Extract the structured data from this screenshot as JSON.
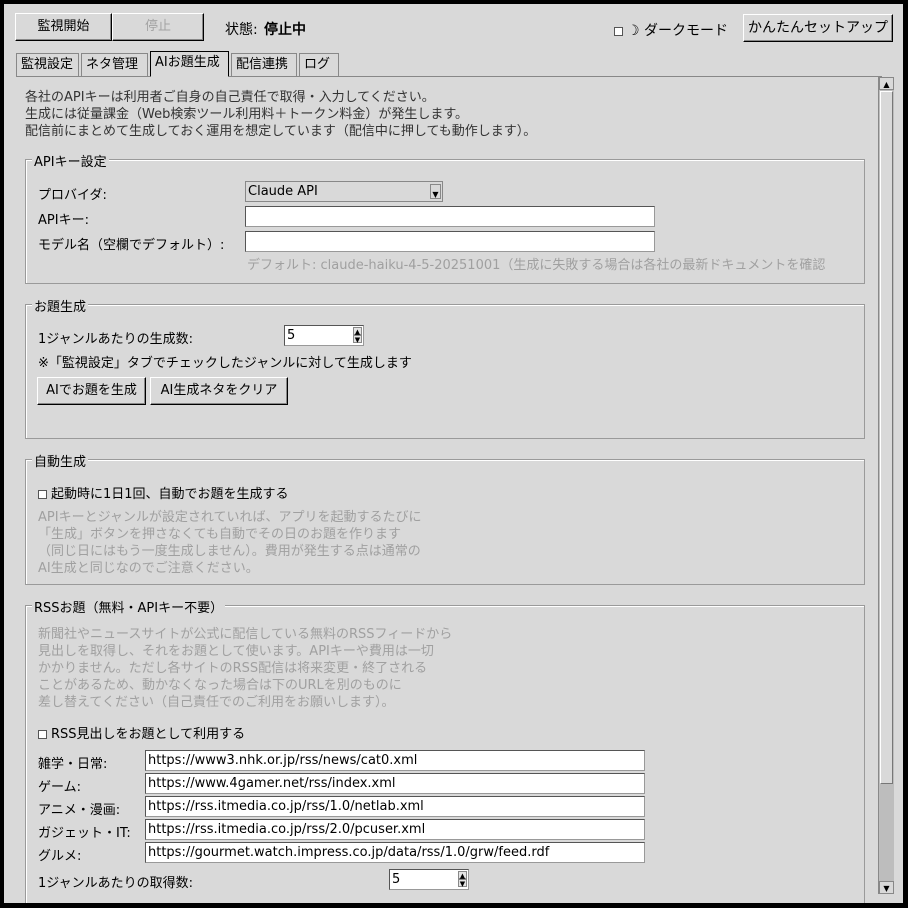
{
  "toolbar": {
    "start_label": "監視開始",
    "stop_label": "停止",
    "status_label": "状態:",
    "status_value": "停止中",
    "dark_mode_label": "ダークモード",
    "dark_mode_icon": "moon-icon",
    "easy_setup_label": "かんたんセットアップ"
  },
  "tabs": [
    {
      "label": "監視設定",
      "active": false
    },
    {
      "label": "ネタ管理",
      "active": false
    },
    {
      "label": "AIお題生成",
      "active": true
    },
    {
      "label": "配信連携",
      "active": false
    },
    {
      "label": "ログ",
      "active": false
    }
  ],
  "notice": [
    "各社のAPIキーは利用者ご自身の自己責任で取得・入力してください。",
    "生成には従量課金（Web検索ツール利用料＋トークン料金）が発生します。",
    "配信前にまとめて生成しておく運用を想定しています（配信中に押しても動作します）。"
  ],
  "api_settings": {
    "title": "APIキー設定",
    "provider_label": "プロバイダ:",
    "provider_value": "Claude API",
    "api_key_label": "APIキー:",
    "api_key_value": "",
    "model_label": "モデル名（空欄でデフォルト）:",
    "model_value": "",
    "default_hint": "デフォルト: claude-haiku-4-5-20251001（生成に失敗する場合は各社の最新ドキュメントを確認"
  },
  "generation": {
    "title": "お題生成",
    "count_label": "1ジャンルあたりの生成数:",
    "count_value": "5",
    "note": "※「監視設定」タブでチェックしたジャンルに対して生成します",
    "generate_label": "AIでお題を生成",
    "clear_label": "AI生成ネタをクリア"
  },
  "auto": {
    "title": "自動生成",
    "checkbox_label": "起動時に1日1回、自動でお題を生成する",
    "checked": false,
    "hint": "APIキーとジャンルが設定されていれば、アプリを起動するたびに\n「生成」ボタンを押さなくても自動でその日のお題を作ります\n（同じ日にはもう一度生成しません）。費用が発生する点は通常の\nAI生成と同じなのでご注意ください。"
  },
  "rss": {
    "title": "RSSお題（無料・APIキー不要）",
    "hint": "新聞社やニュースサイトが公式に配信している無料のRSSフィードから\n見出しを取得し、それをお題として使います。APIキーや費用は一切\nかかりません。ただし各サイトのRSS配信は将来変更・終了される\nことがあるため、動かなくなった場合は下のURLを別のものに\n差し替えてください（自己責任でのご利用をお願いします）。",
    "checkbox_label": "RSS見出しをお題として利用する",
    "checked": false,
    "feeds": [
      {
        "label": "雑学・日常:",
        "url": "https://www3.nhk.or.jp/rss/news/cat0.xml"
      },
      {
        "label": "ゲーム:",
        "url": "https://www.4gamer.net/rss/index.xml"
      },
      {
        "label": "アニメ・漫画:",
        "url": "https://rss.itmedia.co.jp/rss/1.0/netlab.xml"
      },
      {
        "label": "ガジェット・IT:",
        "url": "https://rss.itmedia.co.jp/rss/2.0/pcuser.xml"
      },
      {
        "label": "グルメ:",
        "url": "https://gourmet.watch.impress.co.jp/data/rss/1.0/grw/feed.rdf"
      }
    ],
    "fetch_count_label": "1ジャンルあたりの取得数:",
    "fetch_count_value": "5"
  }
}
